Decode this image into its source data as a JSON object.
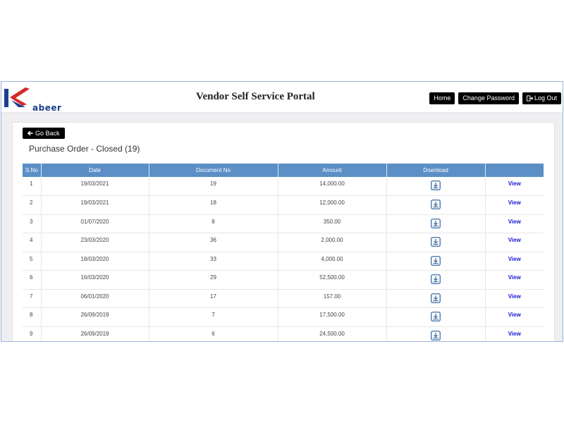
{
  "header": {
    "logo_text": "abeer",
    "title": "Vendor Self Service Portal",
    "nav": {
      "home": "Home",
      "change_password": "Change Password",
      "logout": "Log Out"
    }
  },
  "panel": {
    "back_label": "Go Back",
    "title": "Purchase Order - Closed (19)"
  },
  "table": {
    "columns": [
      "S.No",
      "Date",
      "Document No",
      "Amount",
      "Download",
      ""
    ],
    "view_label": "View",
    "rows": [
      {
        "sno": "1",
        "date": "19/03/2021",
        "doc": "19",
        "amount": "14,000.00"
      },
      {
        "sno": "2",
        "date": "19/03/2021",
        "doc": "18",
        "amount": "12,000.00"
      },
      {
        "sno": "3",
        "date": "01/07/2020",
        "doc": "8",
        "amount": "350.00"
      },
      {
        "sno": "4",
        "date": "23/03/2020",
        "doc": "36",
        "amount": "2,000.00"
      },
      {
        "sno": "5",
        "date": "18/03/2020",
        "doc": "33",
        "amount": "4,000.00"
      },
      {
        "sno": "6",
        "date": "16/03/2020",
        "doc": "29",
        "amount": "52,500.00"
      },
      {
        "sno": "7",
        "date": "06/01/2020",
        "doc": "17",
        "amount": "157.00"
      },
      {
        "sno": "8",
        "date": "26/09/2019",
        "doc": "7",
        "amount": "17,500.00"
      },
      {
        "sno": "9",
        "date": "26/09/2019",
        "doc": "6",
        "amount": "24,500.00"
      }
    ]
  },
  "icons": {
    "back": "arrow-left-icon",
    "logout": "sign-out-icon",
    "download": "download-icon"
  },
  "colors": {
    "header_row": "#5b8fc6",
    "view_link": "#1a1ad8",
    "logo_red": "#d62828",
    "logo_blue": "#1d3f8f"
  }
}
